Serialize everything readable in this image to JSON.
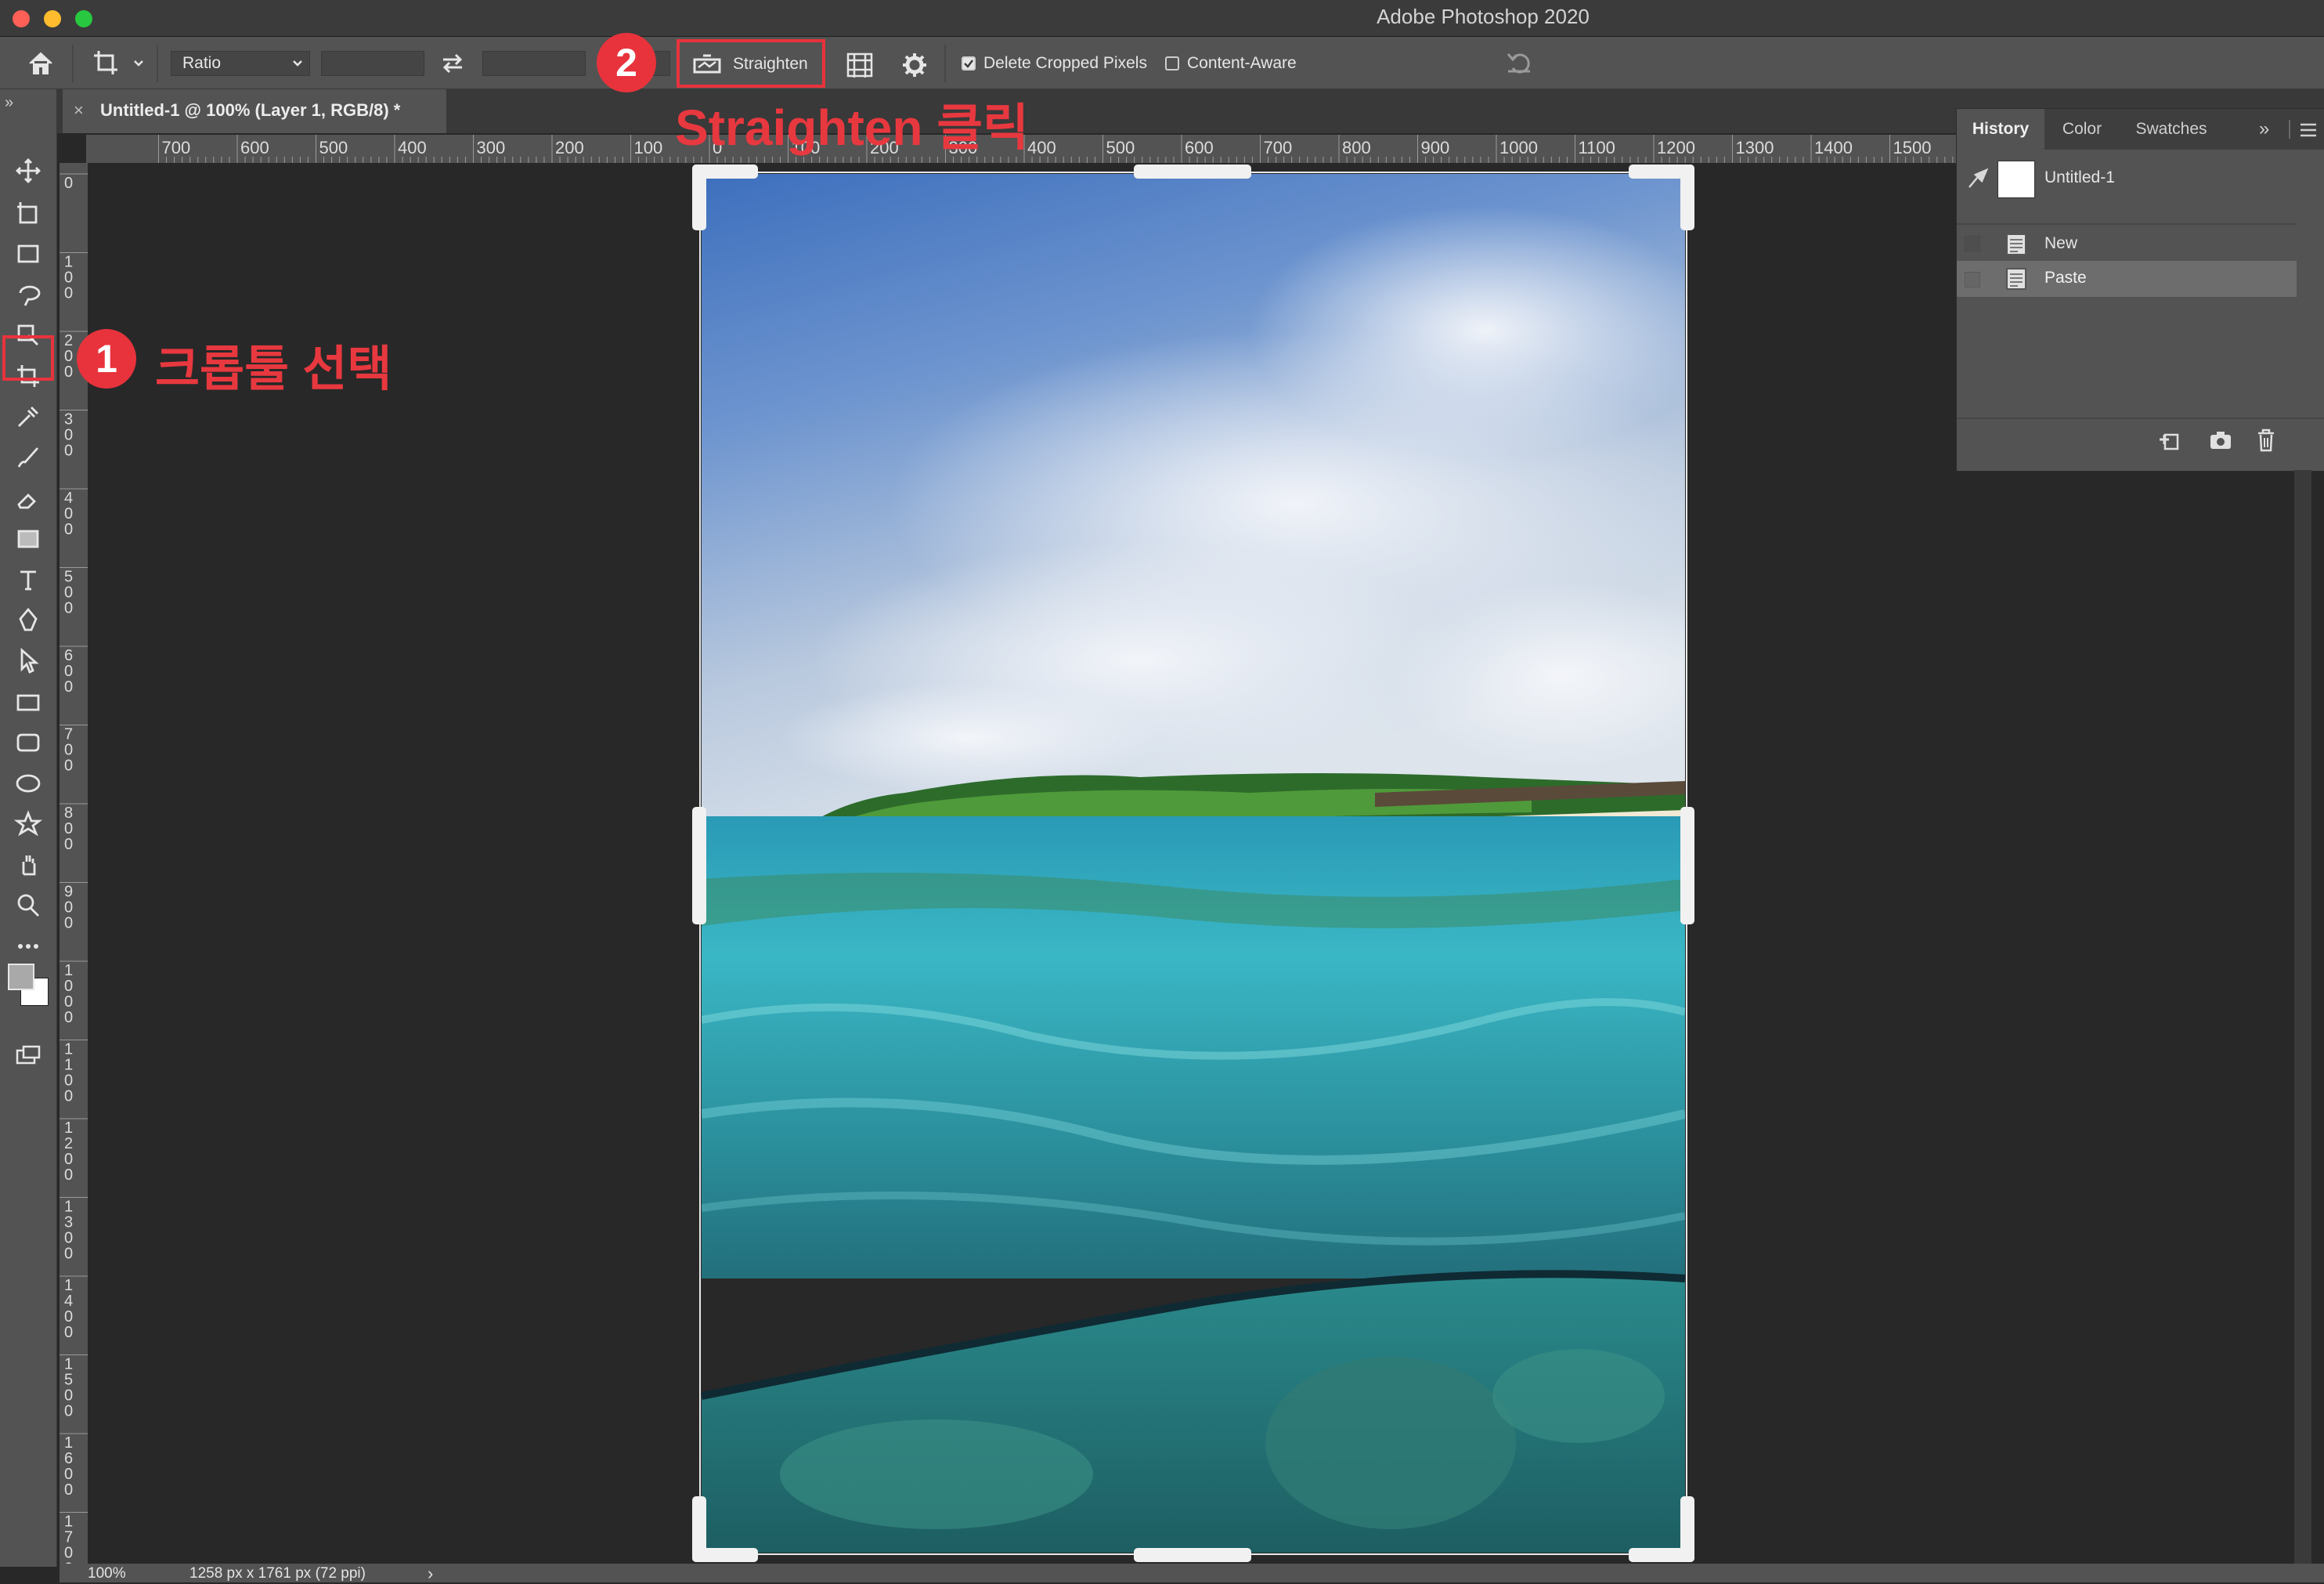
{
  "app": {
    "title": "Adobe Photoshop 2020"
  },
  "options_bar": {
    "ratio_label": "Ratio",
    "straighten_label": "Straighten",
    "delete_cropped_label": "Delete Cropped Pixels",
    "delete_cropped_checked": true,
    "content_aware_label": "Content-Aware",
    "content_aware_checked": false
  },
  "document_tab": {
    "title": "Untitled-1 @ 100% (Layer 1, RGB/8) *",
    "close_glyph": "×"
  },
  "ruler": {
    "h_labels": [
      "700",
      "600",
      "500",
      "400",
      "300",
      "200",
      "100",
      "0",
      "100",
      "200",
      "300",
      "400",
      "500",
      "600",
      "700",
      "800",
      "900",
      "1000",
      "1100",
      "1200",
      "1300",
      "1400",
      "1500"
    ],
    "v_labels": [
      "0",
      "100",
      "200",
      "300",
      "400",
      "500",
      "600",
      "700",
      "800",
      "900",
      "1000",
      "1100",
      "1200",
      "1300",
      "1400",
      "1500",
      "1600",
      "1700"
    ]
  },
  "tools": [
    "move-tool-icon",
    "artboard-tool-icon",
    "marquee-tool-icon",
    "lasso-tool-icon",
    "object-select-tool-icon",
    "crop-tool-icon",
    "eyedropper-tool-icon",
    "brush-tool-icon",
    "eraser-tool-icon",
    "gradient-tool-icon",
    "type-tool-icon",
    "pen-tool-icon",
    "path-select-tool-icon",
    "rectangle-tool-icon",
    "rounded-rect-tool-icon",
    "ellipse-tool-icon",
    "custom-shape-tool-icon",
    "hand-tool-icon",
    "zoom-tool-icon",
    "more-tools-icon"
  ],
  "panel": {
    "tabs": [
      "History",
      "Color",
      "Swatches"
    ],
    "active_tab": "History",
    "snapshot_label": "Untitled-1",
    "items": [
      {
        "label": "New",
        "selected": false
      },
      {
        "label": "Paste",
        "selected": true
      }
    ]
  },
  "status": {
    "zoom": "100%",
    "doc_info": "1258 px x 1761 px (72 ppi)",
    "arrow": "›"
  },
  "annotations": {
    "step1_number": "1",
    "step1_text": "크롭툴 선택",
    "step2_number": "2",
    "step2_text": "Straighten 클릭",
    "color": "#e8333c"
  },
  "colors": {
    "app_bg": "#282828",
    "panel_bg": "#535353",
    "accent": "#e8333c"
  }
}
